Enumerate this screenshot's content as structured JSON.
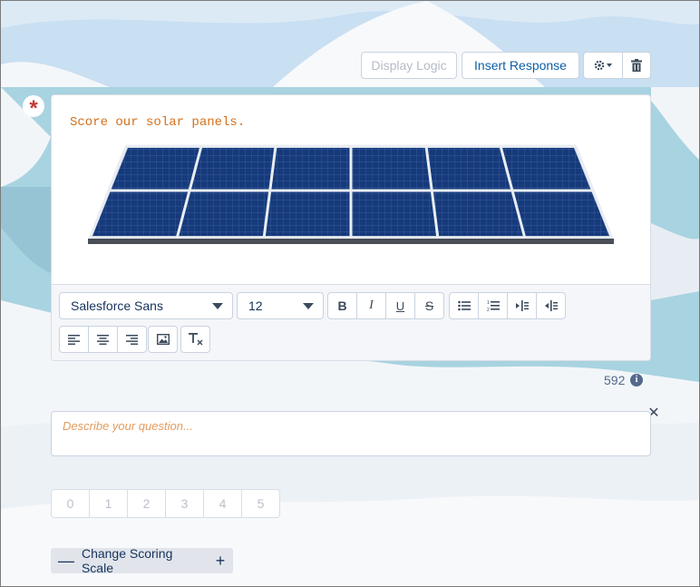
{
  "toolbar": {
    "display_logic_label": "Display Logic",
    "insert_response_label": "Insert Response",
    "settings_icon": "gear-icon",
    "delete_icon": "trash-icon"
  },
  "question": {
    "required_marker": "*",
    "text": "Score our solar panels.",
    "image": "solar-panel"
  },
  "editor": {
    "font_family_value": "Salesforce Sans",
    "font_size_value": "12",
    "buttons": [
      "bold",
      "italic",
      "underline",
      "strikethrough",
      "bullet-list",
      "numbered-list",
      "indent",
      "outdent",
      "align-left",
      "align-center",
      "align-right",
      "insert-image",
      "clear-formatting"
    ]
  },
  "char_count": "592",
  "info_glyph": "i",
  "description": {
    "placeholder": "Describe your question..."
  },
  "scale": {
    "options": [
      "0",
      "1",
      "2",
      "3",
      "4",
      "5"
    ]
  },
  "change_scoring": {
    "label": "Change Scoring Scale",
    "minus": "—",
    "plus": "+"
  },
  "colors": {
    "accent": "#0b5ea8",
    "required": "#c23934",
    "question_text": "#d36f1a"
  }
}
